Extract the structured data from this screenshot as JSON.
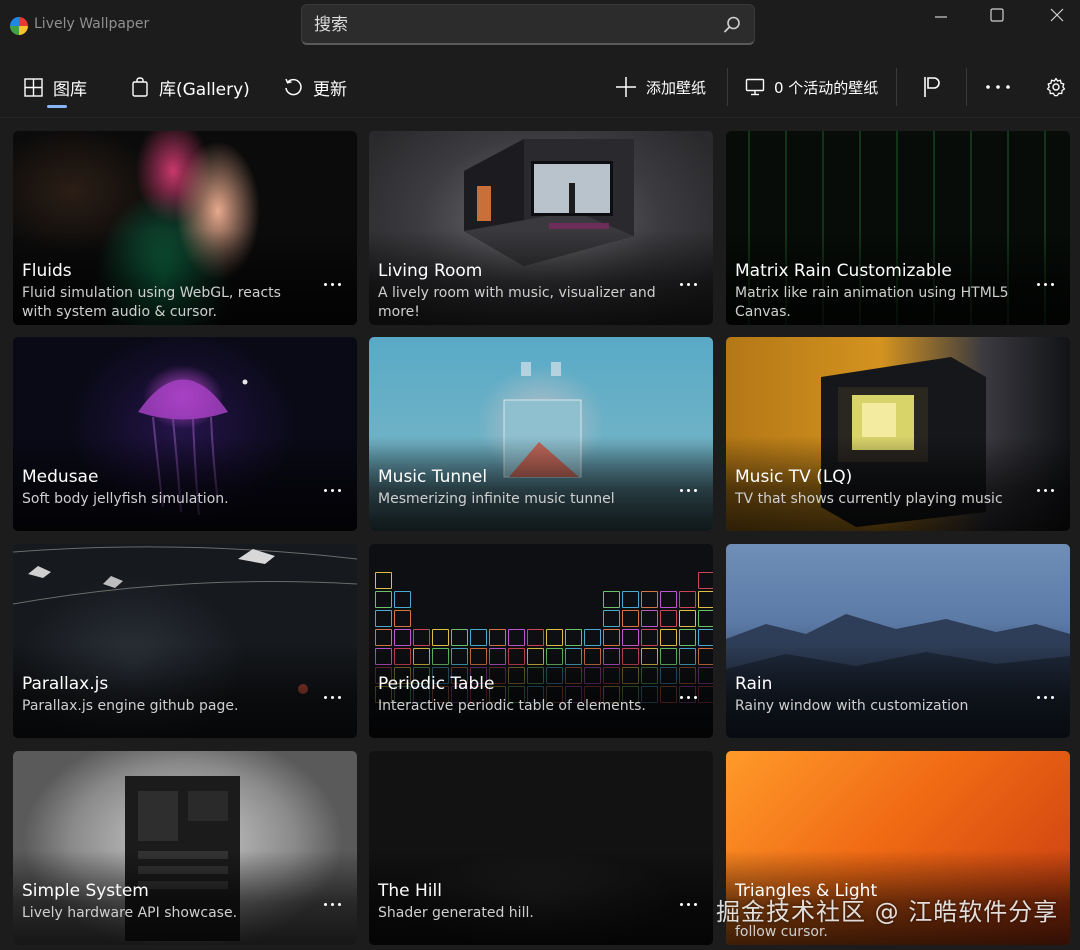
{
  "app": {
    "title": "Lively Wallpaper"
  },
  "search": {
    "placeholder": "搜索"
  },
  "nav": {
    "items": [
      {
        "label": "图库",
        "icon": "grid-icon",
        "selected": true
      },
      {
        "label": "库(Gallery)",
        "icon": "shopping-bag-icon",
        "selected": false
      },
      {
        "label": "更新",
        "icon": "refresh-icon",
        "selected": false
      }
    ]
  },
  "commands": {
    "add_wallpaper": "添加壁纸",
    "active_wallpapers": "0 个活动的壁纸"
  },
  "colors": {
    "accent": "#8ab4f8",
    "background": "#1c1c1c",
    "card": "#222222"
  },
  "cards": [
    {
      "title": "Fluids",
      "description": "Fluid simulation using WebGL, reacts with system audio & cursor."
    },
    {
      "title": "Living Room",
      "description": "A lively room with music, visualizer and more!"
    },
    {
      "title": "Matrix Rain Customizable",
      "description": "Matrix like rain animation using HTML5 Canvas."
    },
    {
      "title": "Medusae",
      "description": "Soft body jellyfish simulation."
    },
    {
      "title": "Music Tunnel",
      "description": "Mesmerizing infinite music tunnel"
    },
    {
      "title": "Music TV (LQ)",
      "description": "TV that shows currently playing music"
    },
    {
      "title": "Parallax.js",
      "description": "Parallax.js engine github page."
    },
    {
      "title": "Periodic Table",
      "description": "Interactive periodic table of elements."
    },
    {
      "title": "Rain",
      "description": "Rainy window with customization"
    },
    {
      "title": "Simple System",
      "description": "Lively hardware API showcase."
    },
    {
      "title": "The Hill",
      "description": "Shader generated hill."
    },
    {
      "title": "Triangles & Light",
      "description": "follow cursor."
    }
  ],
  "watermark": "掘金技术社区 @ 江皓软件分享"
}
